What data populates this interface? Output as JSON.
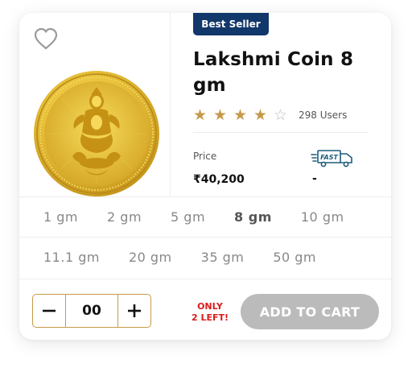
{
  "product": {
    "badge": "Best Seller",
    "title": "Lakshmi Coin 8 gm",
    "rating": {
      "filled_stars": 4,
      "total_stars": 5,
      "users": "298 Users"
    },
    "price_label": "Price",
    "price": "₹40,200",
    "delivery_label": "FAST",
    "delivery_value": "-"
  },
  "sizes": [
    [
      "1 gm",
      "2 gm",
      "5 gm",
      "8 gm",
      "10 gm"
    ],
    [
      "11.1 gm",
      "20 gm",
      "35 gm",
      "50 gm"
    ]
  ],
  "selected_size": "8 gm",
  "cart": {
    "quantity": "00",
    "stock_line1": "ONLY",
    "stock_line2": "2 LEFT!",
    "add_label": "ADD TO CART"
  },
  "colors": {
    "badge_bg": "#12376a",
    "gold": "#c69a49",
    "stock_red": "#d91b1b",
    "button_disabled": "#bbbbbb"
  },
  "icons": [
    "heart-icon",
    "coin-image",
    "fast-delivery-truck-icon",
    "star-icon",
    "minus-icon",
    "plus-icon"
  ]
}
